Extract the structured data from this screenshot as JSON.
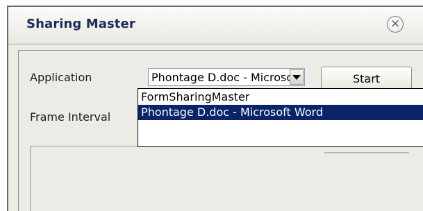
{
  "window": {
    "title": "Sharing Master"
  },
  "form": {
    "application_label": "Application",
    "frame_interval_label": "Frame Interval",
    "application_value": "Phontage D.doc - Microsoft Word",
    "start_label": "Start"
  },
  "dropdown": {
    "options": [
      "FormSharingMaster",
      "Phontage D.doc - Microsoft Word"
    ],
    "selected_index": 1
  },
  "icons": {
    "close": "close-icon",
    "dropdown": "chevron-down-icon"
  },
  "colors": {
    "selection": "#0a246a",
    "title_text": "#1e2a55",
    "window_face": "#ecebe5"
  }
}
